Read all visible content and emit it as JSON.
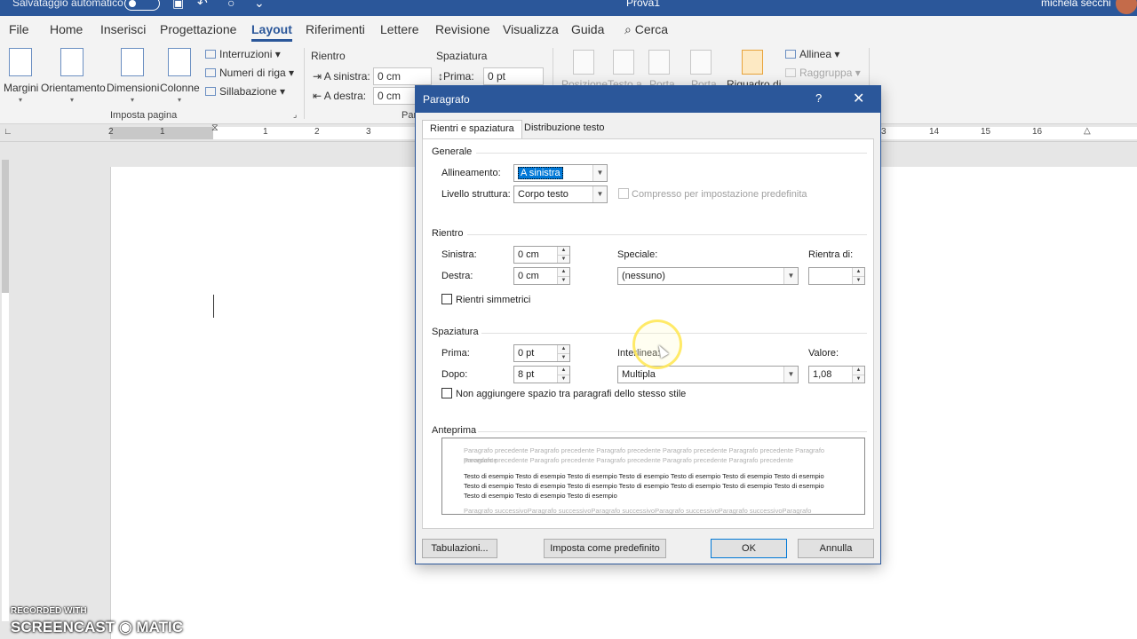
{
  "titlebar": {
    "autosave": "Salvataggio automatico",
    "doc_title": "Prova1",
    "user": "michela secchi"
  },
  "tabs": [
    "File",
    "Home",
    "Inserisci",
    "Progettazione",
    "Layout",
    "Riferimenti",
    "Lettere",
    "Revisione",
    "Visualizza",
    "Guida",
    "Cerca"
  ],
  "active_tab": "Layout",
  "ribbon": {
    "margins": "Margini",
    "orientation": "Orientamento",
    "size": "Dimensioni",
    "columns": "Colonne",
    "breaks": "Interruzioni",
    "line_numbers": "Numeri di riga",
    "hyphenation": "Sillabazione",
    "page_setup_group": "Imposta pagina",
    "indent_title": "Rientro",
    "indent_left_label": "A sinistra:",
    "indent_left_value": "0 cm",
    "indent_right_label": "A destra:",
    "indent_right_value": "0 cm",
    "spacing_title": "Spaziatura",
    "spacing_before_label": "Prima:",
    "spacing_before_value": "0 pt",
    "paragraph_group_partial": "Par",
    "position": "Posizione",
    "wrap_text": "Testo a",
    "bring_forward": "Porta",
    "send_backward": "Porta",
    "selection_pane": "Riquadro di",
    "align": "Allinea",
    "group": "Raggruppa"
  },
  "ruler": {
    "numbers_left": [
      "2",
      "1",
      "1",
      "2",
      "3"
    ],
    "numbers_right": [
      "3",
      "14",
      "15",
      "16"
    ]
  },
  "dialog": {
    "title": "Paragrafo",
    "help": "?",
    "close": "✕",
    "tabs": [
      "Rientri e spaziatura",
      "Distribuzione testo"
    ],
    "general": {
      "section": "Generale",
      "alignment_label": "Allineamento:",
      "alignment_value": "A sinistra",
      "outline_label": "Livello struttura:",
      "outline_value": "Corpo testo",
      "collapsed_label": "Compresso per impostazione predefinita"
    },
    "indent": {
      "section": "Rientro",
      "left_label": "Sinistra:",
      "left_value": "0 cm",
      "right_label": "Destra:",
      "right_value": "0 cm",
      "special_label": "Speciale:",
      "special_value": "(nessuno)",
      "by_label": "Rientra di:",
      "by_value": "",
      "mirror_label": "Rientri simmetrici"
    },
    "spacing": {
      "section": "Spaziatura",
      "before_label": "Prima:",
      "before_value": "0 pt",
      "after_label": "Dopo:",
      "after_value": "8 pt",
      "line_label": "Interlinea:",
      "line_value": "Multipla",
      "at_label": "Valore:",
      "at_value": "1,08",
      "dont_add_label": "Non aggiungere spazio tra paragrafi dello stesso stile"
    },
    "preview": {
      "section": "Anteprima",
      "prev_line1": "Paragrafo precedente Paragrafo precedente Paragrafo precedente Paragrafo precedente Paragrafo precedente Paragrafo precedente",
      "prev_line2": "Paragrafo precedente Paragrafo precedente Paragrafo precedente Paragrafo precedente Paragrafo precedente",
      "sample": "Testo di esempio Testo di esempio Testo di esempio Testo di esempio Testo di esempio Testo di esempio Testo di esempio Testo di esempio Testo di esempio Testo di esempio Testo di esempio Testo di esempio Testo di esempio Testo di esempio Testo di esempio Testo di esempio Testo di esempio",
      "next_line": "Paragrafo successivoParagrafo successivoParagrafo successivoParagrafo successivoParagrafo successivoParagrafo"
    },
    "buttons": {
      "tabs": "Tabulazioni...",
      "default": "Imposta come predefinito",
      "ok": "OK",
      "cancel": "Annulla"
    }
  },
  "watermark": {
    "line1": "RECORDED WITH",
    "line2": "SCREENCAST ◉ MATIC"
  }
}
